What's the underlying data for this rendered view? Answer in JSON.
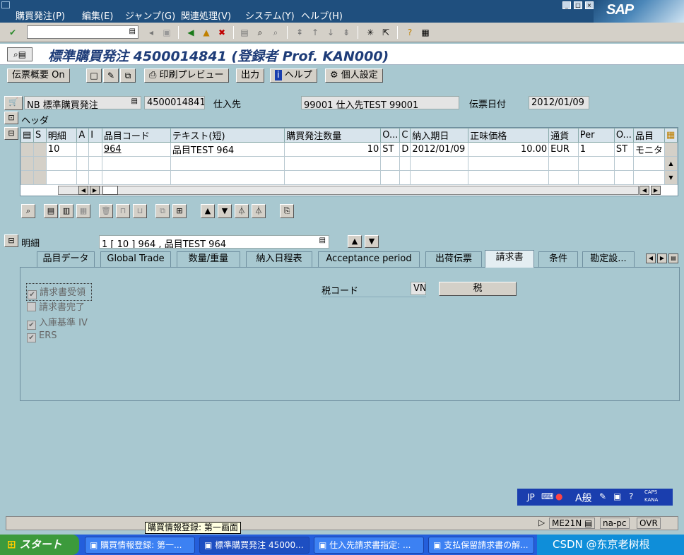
{
  "menu": [
    "購買発注(P)",
    "編集(E)",
    "ジャンプ(G)",
    "関連処理(V)",
    "システム(Y)",
    "ヘルプ(H)"
  ],
  "brand": "SAP",
  "title": "標準購買発注 4500014841 (登録者 Prof. KAN000)",
  "app_toolbar": {
    "doc_overview": "伝票概要 On",
    "print_preview": "印刷プレビュー",
    "output": "出力",
    "help": "ヘルプ",
    "personal_settings": "個人設定"
  },
  "header": {
    "doc_type": "NB 標準購買発注",
    "po_number": "4500014841",
    "vendor_label": "仕入先",
    "vendor_value": "99001 仕入先TEST 99001",
    "doc_date_label": "伝票日付",
    "doc_date_value": "2012/01/09",
    "header_label": "ヘッダ"
  },
  "grid": {
    "columns": [
      "S",
      "明細",
      "A",
      "I",
      "品目コード",
      "テキスト(短)",
      "購買発注数量",
      "O...",
      "C",
      "納入期日",
      "正味価格",
      "通貨",
      "Per",
      "O...",
      "品目"
    ],
    "rows": [
      {
        "item": "10",
        "material": "964",
        "text": "品目TEST 964",
        "qty": "10",
        "unit": "ST",
        "cat": "D",
        "delivery": "2012/01/09",
        "price": "10.00",
        "currency": "EUR",
        "per": "1",
        "order_unit": "ST",
        "group": "モニタ"
      }
    ]
  },
  "detail": {
    "label": "明細",
    "selector": "1 [ 10 ] 964 , 品目TEST 964"
  },
  "tabs": [
    "品目データ",
    "Global Trade",
    "数量/重量",
    "納入日程表",
    "Acceptance period",
    "出荷伝票",
    "請求書",
    "条件",
    "勘定設..."
  ],
  "active_tab": "請求書",
  "invoice": {
    "checkboxes": [
      {
        "label": "請求書受領",
        "checked": true
      },
      {
        "label": "請求書完了",
        "checked": false
      },
      {
        "label": "入庫基準 IV",
        "checked": true
      },
      {
        "label": "ERS",
        "checked": true
      }
    ],
    "tax_code_label": "税コード",
    "tax_code_value": "VN",
    "tax_button": "税"
  },
  "ime": {
    "lang": "JP",
    "mode": "A般",
    "caps": "CAPS",
    "kana": "KANA"
  },
  "status": {
    "tooltip": "購買情報登録: 第一画面",
    "transaction": "ME21N",
    "host": "na-pc",
    "mode": "OVR"
  },
  "taskbar": {
    "start": "スタート",
    "tasks": [
      "購買情報登録: 第一...",
      "標準購買発注 45000...",
      "仕入先請求書指定: ...",
      "支払保留請求書の解..."
    ],
    "tray": "CSDN @东京老树根"
  }
}
